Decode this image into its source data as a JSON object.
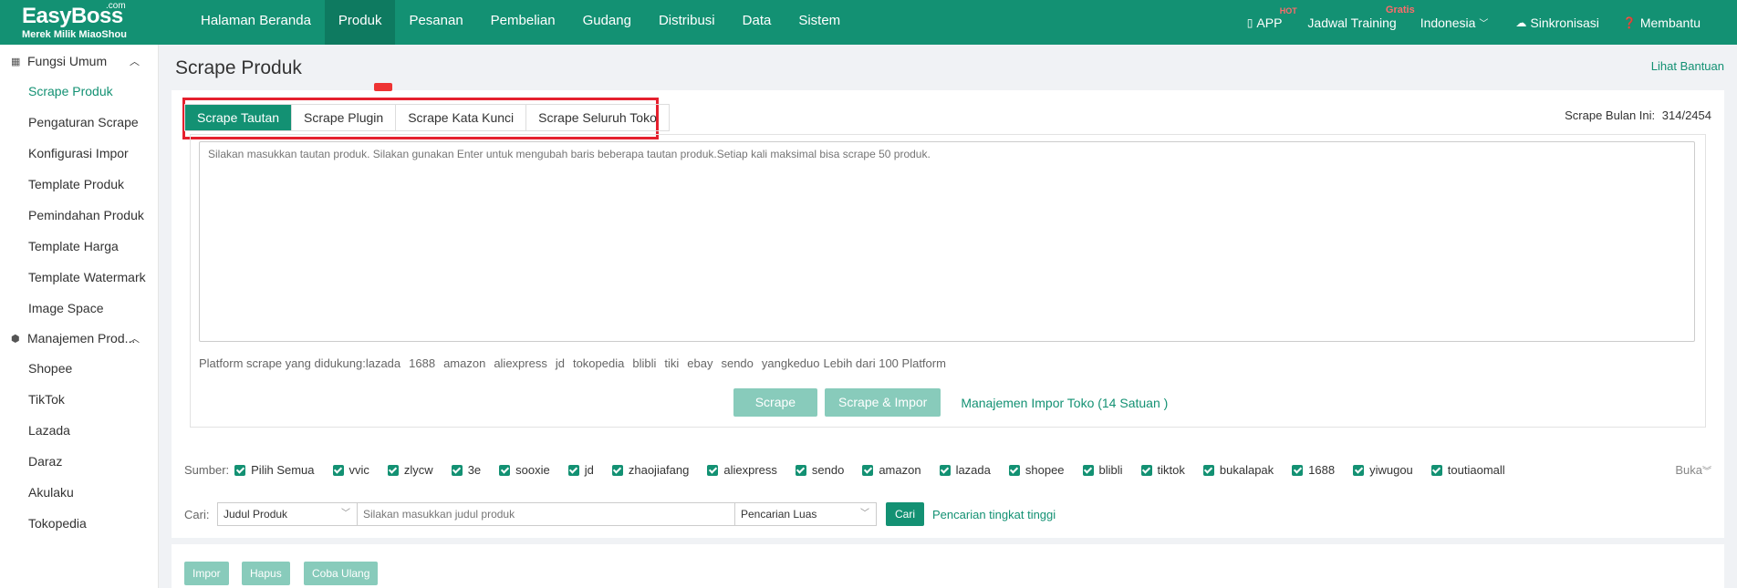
{
  "brand": {
    "name": "EasyBoss",
    "com": ".com",
    "tagline": "Merek Milik MiaoShou"
  },
  "nav": [
    {
      "label": "Halaman Beranda"
    },
    {
      "label": "Produk"
    },
    {
      "label": "Pesanan"
    },
    {
      "label": "Pembelian"
    },
    {
      "label": "Gudang"
    },
    {
      "label": "Distribusi"
    },
    {
      "label": "Data"
    },
    {
      "label": "Sistem"
    }
  ],
  "right_nav": {
    "app": "APP",
    "app_badge": "HOT",
    "training": "Jadwal Training",
    "training_badge": "Gratis",
    "language": "Indonesia",
    "sync": "Sinkronisasi",
    "help": "Membantu"
  },
  "sidebar": {
    "group1": "Fungsi Umum",
    "items1": [
      "Scrape Produk",
      "Pengaturan Scrape",
      "Konfigurasi Impor",
      "Template Produk",
      "Pemindahan Produk",
      "Template Harga",
      "Template Watermark",
      "Image Space"
    ],
    "group2": "Manajemen Prod...",
    "items2": [
      "Shopee",
      "TikTok",
      "Lazada",
      "Daraz",
      "Akulaku",
      "Tokopedia"
    ]
  },
  "page": {
    "title": "Scrape Produk",
    "help_link": "Lihat Bantuan",
    "tabs": [
      "Scrape Tautan",
      "Scrape Plugin",
      "Scrape Kata Kunci",
      "Scrape Seluruh Toko"
    ],
    "quota_label": "Scrape Bulan Ini:",
    "quota_value": "314/2454",
    "textarea_placeholder": "Silakan masukkan tautan produk. Silakan gunakan Enter untuk mengubah baris beberapa tautan produk.Setiap kali maksimal bisa scrape 50 produk.",
    "platforms_label": "Platform scrape yang didukung:",
    "platforms": [
      "lazada",
      "1688",
      "amazon",
      "aliexpress",
      "jd",
      "tokopedia",
      "blibli",
      "tiki",
      "ebay",
      "sendo",
      "yangkeduo"
    ],
    "platforms_more": "Lebih dari 100 Platform",
    "btn_scrape": "Scrape",
    "btn_scrape_import": "Scrape & Impor",
    "store_link": "Manajemen Impor Toko (14 Satuan )"
  },
  "filter": {
    "source_label": "Sumber:",
    "sources": [
      "Pilih Semua",
      "vvic",
      "zlycw",
      "3e",
      "sooxie",
      "jd",
      "zhaojiafang",
      "aliexpress",
      "sendo",
      "amazon",
      "lazada",
      "shopee",
      "blibli",
      "tiktok",
      "bukalapak",
      "1688",
      "yiwugou",
      "toutiaomall"
    ],
    "expand": "Buka",
    "search_label": "Cari:",
    "field_select": "Judul Produk",
    "search_placeholder": "Silakan masukkan judul produk",
    "mode_select": "Pencarian Luas",
    "btn_search": "Cari",
    "advanced": "Pencarian tingkat tinggi"
  },
  "actions": {
    "import": "Impor",
    "delete": "Hapus",
    "retry": "Coba Ulang"
  },
  "colors": {
    "primary": "#139173",
    "disabled": "#88cbbb",
    "highlight": "#e5202e"
  }
}
